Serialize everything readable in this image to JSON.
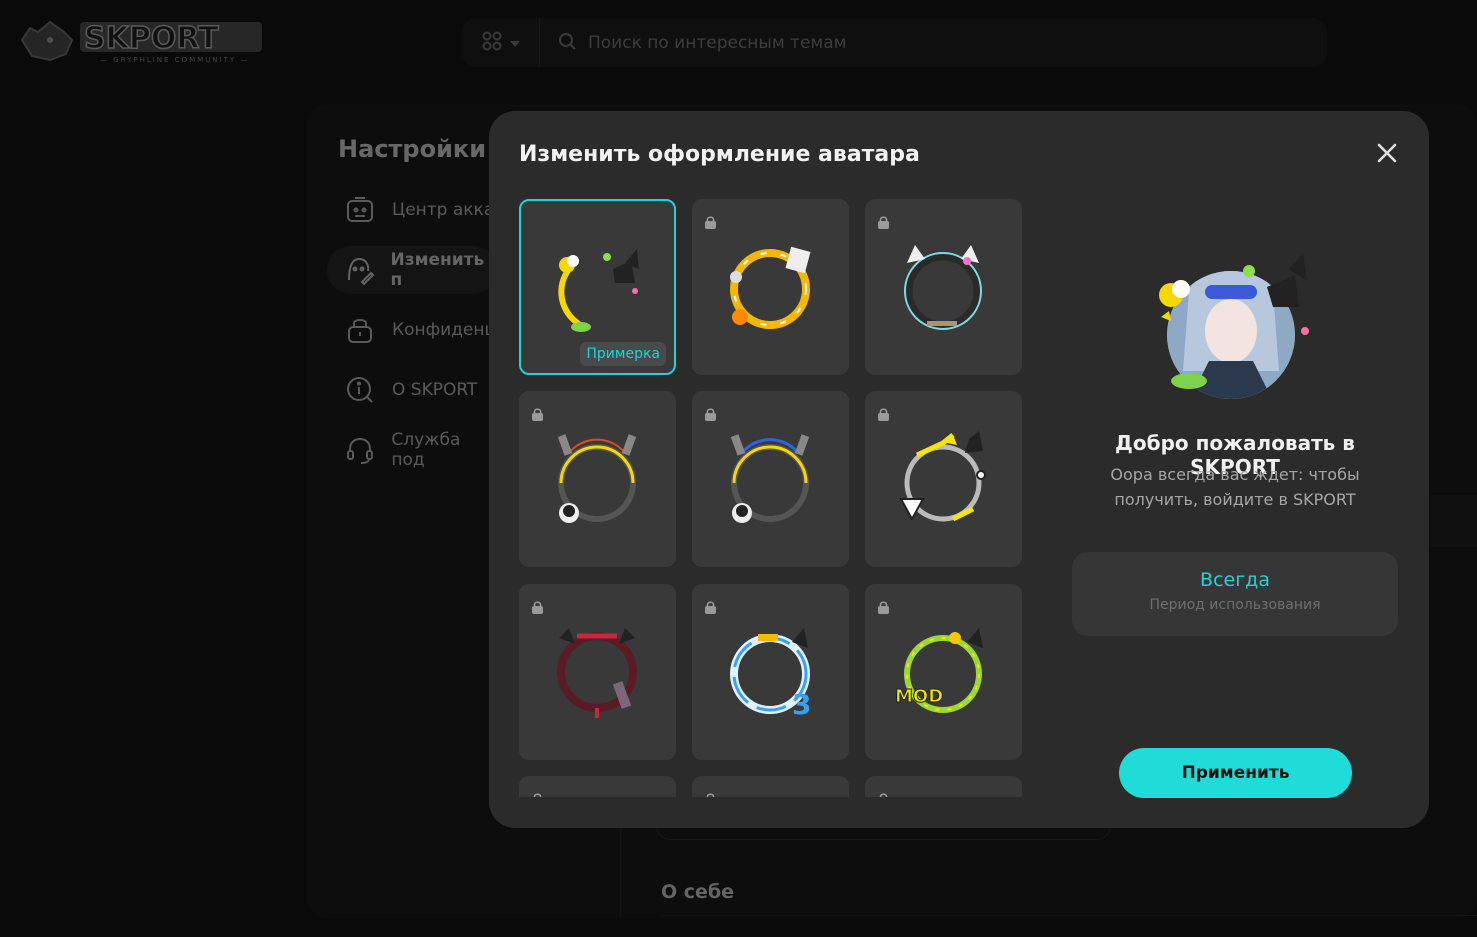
{
  "header": {
    "logo_text": "SKPORT",
    "logo_subtext": "GRYPHLINE COMMUNITY",
    "search_placeholder": "Поиск по интересным темам"
  },
  "settings": {
    "title": "Настройки",
    "items": [
      {
        "label": "Центр акка",
        "icon": "account-card-icon",
        "active": false
      },
      {
        "label": "Изменить п",
        "icon": "edit-profile-icon",
        "active": true
      },
      {
        "label": "Конфиденц",
        "icon": "privacy-lock-icon",
        "active": false
      },
      {
        "label": "О SKPORT",
        "icon": "info-icon",
        "active": false
      },
      {
        "label": "Служба под",
        "icon": "headset-icon",
        "active": false
      }
    ],
    "about_me": "О себе"
  },
  "modal": {
    "title": "Изменить оформление аватара",
    "frames": [
      {
        "name": "frame-sun-cat",
        "locked": false,
        "selected": true,
        "badge": "Примерка"
      },
      {
        "name": "frame-yellow-mech",
        "locked": true
      },
      {
        "name": "frame-cat-ears",
        "locked": true
      },
      {
        "name": "frame-headphones-yellow",
        "locked": true
      },
      {
        "name": "frame-headphones-blue",
        "locked": true
      },
      {
        "name": "frame-arrows",
        "locked": true
      },
      {
        "name": "frame-red-ribbon",
        "locked": true
      },
      {
        "name": "frame-wave-3",
        "locked": true
      },
      {
        "name": "frame-mod-green",
        "locked": true
      },
      {
        "name": "frame-partial-1",
        "locked": true
      },
      {
        "name": "frame-partial-2",
        "locked": true
      },
      {
        "name": "frame-partial-3",
        "locked": true
      }
    ],
    "welcome_title": "Добро пожаловать в SKPORT",
    "welcome_text": "Оора всегда вас ждет: чтобы получить, войдите в SKPORT",
    "period_value": "Всегда",
    "period_label": "Период использования",
    "apply_label": "Применить"
  },
  "colors": {
    "accent": "#1fd3d6",
    "modal_bg": "#2b2b2b",
    "page_bg": "#101010"
  }
}
